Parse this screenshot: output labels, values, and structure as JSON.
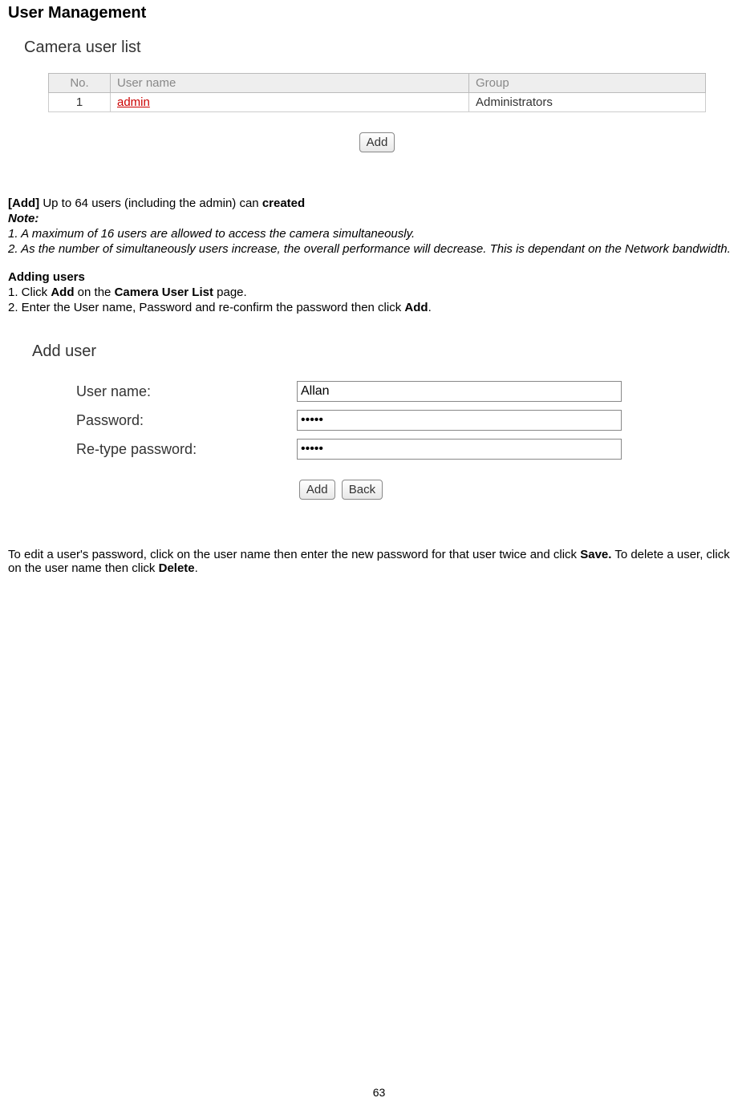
{
  "page": {
    "title": "User Management",
    "number": "63"
  },
  "user_list": {
    "heading": "Camera user list",
    "columns": {
      "no": "No.",
      "username": "User name",
      "group": "Group"
    },
    "rows": [
      {
        "no": "1",
        "username": "admin",
        "group": "Administrators"
      }
    ],
    "add_button": "Add"
  },
  "add_desc": {
    "label": "[Add]",
    "text_before": " Up to 64 users (including the admin) can ",
    "text_bold": "created"
  },
  "note": {
    "label": "Note:",
    "line1": "1. A maximum of 16 users are allowed to access the camera simultaneously.",
    "line2": "2. As the number of simultaneously users increase, the overall performance will decrease. This is dependant on the Network bandwidth."
  },
  "adding_users": {
    "heading": "Adding users",
    "step1_prefix": "1. Click ",
    "step1_bold1": "Add",
    "step1_mid": " on the ",
    "step1_bold2": "Camera User List",
    "step1_suffix": " page.",
    "step2_prefix": "2. Enter the User name, Password and re-confirm the password then click ",
    "step2_bold": "Add",
    "step2_suffix": "."
  },
  "add_user_form": {
    "heading": "Add user",
    "username_label": "User name:",
    "username_value": "Allan",
    "password_label": "Password:",
    "password_value": "•••••",
    "retype_label": "Re-type password:",
    "retype_value": "•••••",
    "add_button": "Add",
    "back_button": "Back"
  },
  "edit_para": {
    "part1": "To edit a user's password, click on the user name then enter the new password for that user twice and click ",
    "bold1": "Save.",
    "part2": " To delete a user, click on the user name then click ",
    "bold2": "Delete",
    "part3": "."
  }
}
